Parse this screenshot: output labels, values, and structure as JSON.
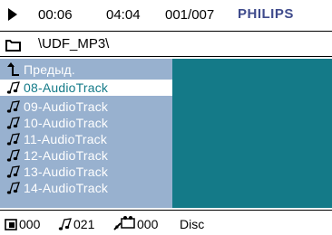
{
  "header": {
    "elapsed": "00:06",
    "total": "04:04",
    "track_counter": "001/007",
    "brand": "PHILIPS"
  },
  "path": "\\UDF_MP3\\",
  "list": {
    "items": [
      {
        "label": "Предыд.",
        "icon": "folder-up-icon",
        "selected": false
      },
      {
        "label": "08-AudioTrack",
        "icon": "music-note-icon",
        "selected": true
      },
      {
        "label": "09-AudioTrack",
        "icon": "music-note-icon",
        "selected": false
      },
      {
        "label": "10-AudioTrack",
        "icon": "music-note-icon",
        "selected": false
      },
      {
        "label": "11-AudioTrack",
        "icon": "music-note-icon",
        "selected": false
      },
      {
        "label": "12-AudioTrack",
        "icon": "music-note-icon",
        "selected": false
      },
      {
        "label": "13-AudioTrack",
        "icon": "music-note-icon",
        "selected": false
      },
      {
        "label": "14-AudioTrack",
        "icon": "music-note-icon",
        "selected": false
      }
    ]
  },
  "status": {
    "folders": "000",
    "audio": "021",
    "pictures": "000",
    "media": "Disc"
  },
  "colors": {
    "panel": "#98b1cf",
    "preview": "#147a88",
    "brand": "#3f4b8c"
  }
}
